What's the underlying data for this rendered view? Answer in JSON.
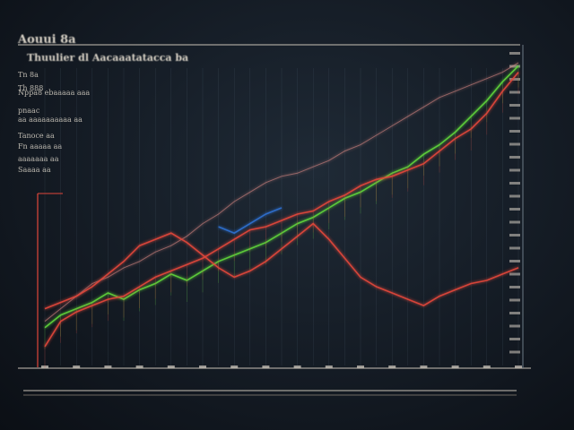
{
  "header": {
    "brand": "Aouui 8a",
    "subtitle": "Thuulier dl Aacaaatatacca ba"
  },
  "side_notes": [
    "Tn 8a",
    "Th 888",
    "Nppa8 ebaaaaa aaa",
    "pnaac",
    "aa aaaaaaaaaa aa",
    "Tanoce aa",
    "Fn aaaaa aa",
    "aaaaaaa aa",
    "Saaaa aa"
  ],
  "colors": {
    "background": "#141b24",
    "frame": "#c9c2b6",
    "grid": "#5e7184",
    "green": "#5fd23a",
    "lime": "#b7e33a",
    "red": "#e0463a",
    "pink": "#e8908a",
    "blue": "#2f6fd0",
    "text": "#d8d2c6"
  },
  "chart_data": {
    "type": "line",
    "title": "Thuulier dl Aacaaatatacca ba",
    "xlabel": "",
    "ylabel": "",
    "grid": true,
    "x": [
      0,
      1,
      2,
      3,
      4,
      5,
      6,
      7,
      8,
      9,
      10,
      11,
      12,
      13,
      14,
      15,
      16,
      17,
      18,
      19,
      20,
      21,
      22,
      23,
      24,
      25,
      26,
      27,
      28,
      29,
      30
    ],
    "ylim": [
      0,
      100
    ],
    "series": [
      {
        "values": [
          12,
          16,
          18,
          20,
          23,
          21,
          24,
          26,
          29,
          27,
          30,
          33,
          35,
          37,
          39,
          42,
          45,
          47,
          50,
          53,
          55,
          58,
          61,
          63,
          67,
          70,
          74,
          79,
          84,
          90,
          95
        ],
        "color": "green"
      },
      {
        "values": [
          6,
          14,
          17,
          19,
          21,
          22,
          25,
          28,
          30,
          32,
          34,
          37,
          40,
          43,
          44,
          46,
          48,
          49,
          52,
          54,
          57,
          59,
          60,
          62,
          64,
          68,
          72,
          75,
          80,
          87,
          93
        ],
        "color": "red"
      },
      {
        "values": [
          14,
          18,
          22,
          26,
          28,
          31,
          33,
          36,
          38,
          41,
          45,
          48,
          52,
          55,
          58,
          60,
          61,
          63,
          65,
          68,
          70,
          73,
          76,
          79,
          82,
          85,
          87,
          89,
          91,
          93,
          96
        ],
        "color": "pink"
      },
      {
        "values": [
          18,
          20,
          22,
          25,
          29,
          33,
          38,
          40,
          42,
          39,
          35,
          31,
          28,
          30,
          33,
          37,
          41,
          45,
          40,
          34,
          28,
          25,
          23,
          21,
          19,
          22,
          24,
          26,
          27,
          29,
          31
        ],
        "color": "red"
      },
      {
        "values": [
          null,
          null,
          null,
          null,
          null,
          null,
          null,
          null,
          null,
          null,
          null,
          44,
          42,
          45,
          48,
          50,
          null,
          null,
          null,
          null,
          null,
          null,
          null,
          null,
          null,
          null,
          null,
          null,
          null,
          null,
          null
        ],
        "color": "blue"
      }
    ]
  }
}
